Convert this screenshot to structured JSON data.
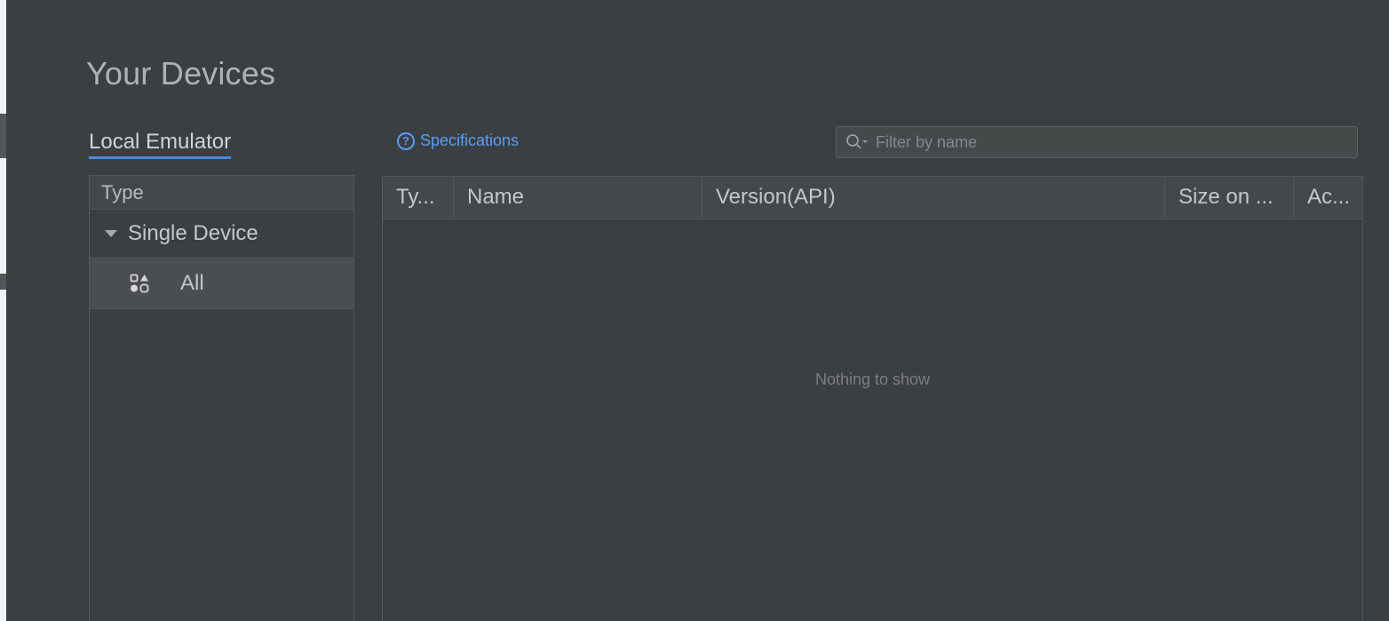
{
  "dialog": {
    "title": "Your Devices"
  },
  "tabs": {
    "local": "Local Emulator"
  },
  "specifications_link": "Specifications",
  "search": {
    "placeholder": "Filter by name",
    "value": ""
  },
  "left_panel": {
    "header": "Type",
    "group": "Single Device",
    "items": [
      {
        "label": "All",
        "icon": "category-icon"
      }
    ]
  },
  "table": {
    "columns": [
      "Ty...",
      "Name",
      "Version(API)",
      "Size on ...",
      "Ac..."
    ],
    "empty_text": "Nothing to show"
  },
  "colors": {
    "background": "#3c3f41",
    "accent": "#4a88d8",
    "link": "#589df6"
  }
}
